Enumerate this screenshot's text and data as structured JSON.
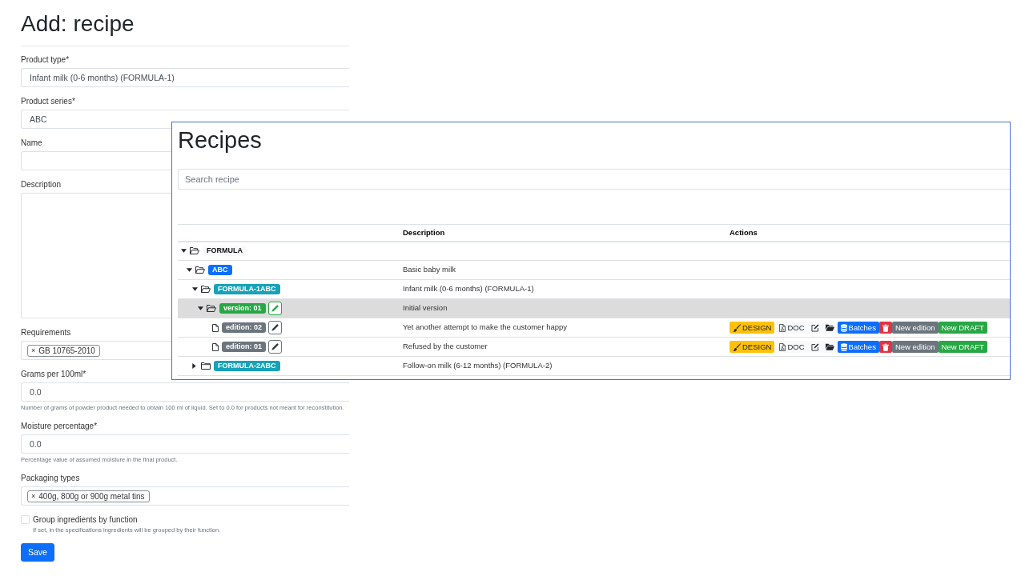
{
  "form": {
    "title": "Add: recipe",
    "fields": [
      {
        "kind": "input",
        "label": "Product type*",
        "value": "Infant milk (0-6 months) (FORMULA-1)"
      },
      {
        "kind": "input",
        "label": "Product series*",
        "value": "ABC"
      },
      {
        "kind": "input",
        "label": "Name"
      },
      {
        "kind": "textarea",
        "label": "Description"
      },
      {
        "kind": "tags",
        "label": "Requirements",
        "tags": [
          {
            "remove": "×",
            "label": "GB 10765-2010"
          }
        ]
      },
      {
        "kind": "input",
        "label": "Grams per 100ml*",
        "value": "0.0",
        "help": "Number of grams of powder product needed to obtain 100 ml of liquid. Set to 0.0 for products not meant for reconstitution."
      },
      {
        "kind": "input",
        "label": "Moisture percentage*",
        "value": "0.0",
        "help": "Percentage value of assumed moisture in the final product."
      },
      {
        "kind": "tags",
        "label": "Packaging types",
        "tags": [
          {
            "remove": "×",
            "label": "400g, 800g or 900g metal tins"
          }
        ]
      },
      {
        "kind": "checkbox",
        "label": "Group ingredients by function",
        "checked": false,
        "help": "If set, in the specifications ingredients will be grouped by their function."
      }
    ],
    "submit": "Save"
  },
  "recipes_panel": {
    "title": "Recipes",
    "search": {
      "placeholder": "Search recipe"
    },
    "table": {
      "columns": [
        "Description",
        "Actions"
      ],
      "tree": [
        {
          "kind": "group",
          "label": "FORMULA",
          "expanded": true,
          "selected": false,
          "children": [
            {
              "kind": "series",
              "label": "ABC",
              "description": "Basic baby milk",
              "expanded": true,
              "selected": false,
              "children": [
                {
                  "kind": "product",
                  "label": "FORMULA-1ABC",
                  "description": "Infant milk (0-6 months) (FORMULA-1)",
                  "expanded": true,
                  "selected": false,
                  "children": [
                    {
                      "kind": "version",
                      "label": "version: 01",
                      "description": "Initial version",
                      "expanded": true,
                      "selected": true,
                      "children": [
                        {
                          "kind": "edition",
                          "label": "edition: 02",
                          "description": "Yet another attempt to make the customer happy",
                          "selected": false,
                          "actions": [
                            {
                              "kind": "design",
                              "label": "DESIGN"
                            },
                            {
                              "kind": "doc",
                              "label": "DOC"
                            },
                            {
                              "kind": "edit"
                            },
                            {
                              "kind": "files"
                            },
                            {
                              "kind": "batches",
                              "label": "Batches"
                            },
                            {
                              "kind": "delete"
                            },
                            {
                              "kind": "new-edition",
                              "label": "New edition"
                            },
                            {
                              "kind": "new-draft",
                              "label": "New DRAFT"
                            }
                          ]
                        },
                        {
                          "kind": "edition",
                          "label": "edition: 01",
                          "description": "Refused by the customer",
                          "selected": false,
                          "actions": [
                            {
                              "kind": "design",
                              "label": "DESIGN"
                            },
                            {
                              "kind": "doc",
                              "label": "DOC"
                            },
                            {
                              "kind": "edit"
                            },
                            {
                              "kind": "files"
                            },
                            {
                              "kind": "batches",
                              "label": "Batches"
                            },
                            {
                              "kind": "delete"
                            },
                            {
                              "kind": "new-edition",
                              "label": "New edition"
                            },
                            {
                              "kind": "new-draft",
                              "label": "New DRAFT"
                            }
                          ]
                        }
                      ]
                    }
                  ]
                },
                {
                  "kind": "product",
                  "label": "FORMULA-2ABC",
                  "description": "Follow-on milk (6-12 months) (FORMULA-2)",
                  "expanded": false,
                  "selected": false
                }
              ]
            }
          ]
        }
      ]
    }
  }
}
